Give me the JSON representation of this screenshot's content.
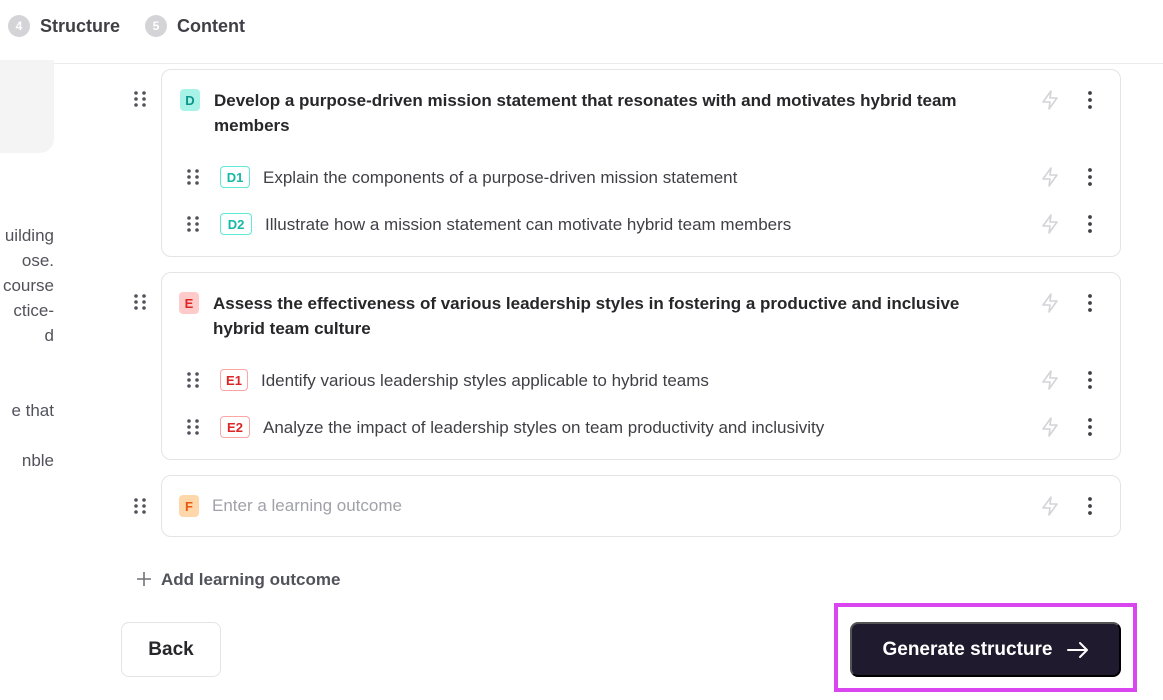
{
  "stepper": {
    "steps": [
      {
        "number": "4",
        "label": "Structure"
      },
      {
        "number": "5",
        "label": "Content"
      }
    ]
  },
  "left_panel": {
    "lines": [
      "uilding",
      "ose.",
      "course",
      "ctice-",
      "d",
      "",
      "",
      "e that",
      "",
      "nble"
    ]
  },
  "outcomes": [
    {
      "badge": "D",
      "title": "Develop a purpose-driven mission statement that resonates with and motivates hybrid team members",
      "subs": [
        {
          "badge": "D1",
          "text": "Explain the components of a purpose-driven mission statement"
        },
        {
          "badge": "D2",
          "text": "Illustrate how a mission statement can motivate hybrid team members"
        }
      ]
    },
    {
      "badge": "E",
      "title": "Assess the effectiveness of various leadership styles in fostering a productive and inclusive hybrid team culture",
      "subs": [
        {
          "badge": "E1",
          "text": "Identify various leadership styles applicable to hybrid teams"
        },
        {
          "badge": "E2",
          "text": "Analyze the impact of leadership styles on team productivity and inclusivity"
        }
      ]
    },
    {
      "badge": "F",
      "placeholder": "Enter a learning outcome"
    }
  ],
  "add_outcome": {
    "label": "Add learning outcome",
    "icon": "plus-icon"
  },
  "buttons": {
    "back": "Back",
    "generate": "Generate structure"
  },
  "colors": {
    "accent_dark": "#1f1a2e",
    "highlight": "#d946ef",
    "badge_d": "#a7f3e7",
    "badge_e": "#fecaca",
    "badge_f": "#fed7aa"
  }
}
